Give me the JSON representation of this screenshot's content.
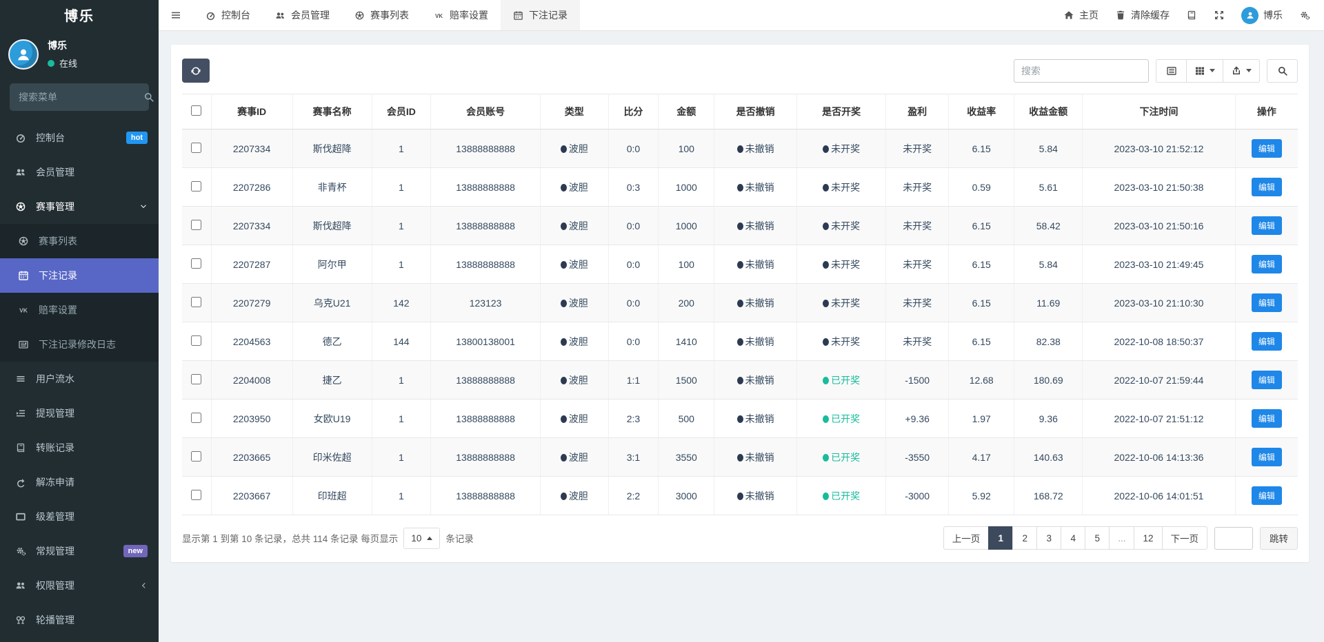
{
  "app": {
    "brand": "博乐"
  },
  "colors": {
    "sidebar_bg": "#222d32",
    "submenu_bg": "#1b252a",
    "active_menu": "#5867c6",
    "hot_badge": "#2196f3",
    "new_badge": "#7266ba",
    "online_dot": "#18bc9c",
    "primary_button": "#1e87e8",
    "pager_active": "#3d4a5d",
    "status_navy_dot": "#2c3a52",
    "drawn_green": "#18bc9c"
  },
  "sidebar": {
    "user": {
      "name": "博乐",
      "status": "在线"
    },
    "search_placeholder": "搜索菜单",
    "items": [
      {
        "id": "console",
        "label": "控制台",
        "icon": "gauge",
        "badge": "hot"
      },
      {
        "id": "member",
        "label": "会员管理",
        "icon": "users"
      },
      {
        "id": "match",
        "label": "赛事管理",
        "icon": "futbol",
        "open": true,
        "chevron": "down"
      },
      {
        "id": "match-list",
        "label": "赛事列表",
        "icon": "futbol",
        "sub": true
      },
      {
        "id": "bet-record",
        "label": "下注记录",
        "icon": "calendar",
        "sub": true,
        "active": true
      },
      {
        "id": "odds",
        "label": "赔率设置",
        "icon": "vk",
        "sub": true
      },
      {
        "id": "bet-log",
        "label": "下注记录修改日志",
        "icon": "log",
        "sub": true
      },
      {
        "id": "user-flow",
        "label": "用户流水",
        "icon": "flow"
      },
      {
        "id": "withdraw",
        "label": "提现管理",
        "icon": "withdraw"
      },
      {
        "id": "transfer",
        "label": "转账记录",
        "icon": "book"
      },
      {
        "id": "unfreeze",
        "label": "解冻申请",
        "icon": "redo"
      },
      {
        "id": "level",
        "label": "级差管理",
        "icon": "window"
      },
      {
        "id": "general",
        "label": "常规管理",
        "icon": "cogs",
        "badge": "new"
      },
      {
        "id": "permission",
        "label": "权限管理",
        "icon": "users",
        "chevron": "left"
      },
      {
        "id": "carousel",
        "label": "轮播管理",
        "icon": "rings"
      }
    ]
  },
  "topnav": {
    "tabs": [
      {
        "id": "console",
        "label": "控制台",
        "icon": "gauge"
      },
      {
        "id": "member",
        "label": "会员管理",
        "icon": "users"
      },
      {
        "id": "match-list",
        "label": "赛事列表",
        "icon": "futbol"
      },
      {
        "id": "odds",
        "label": "赔率设置",
        "icon": "vk"
      },
      {
        "id": "bet-record",
        "label": "下注记录",
        "icon": "calendar",
        "active": true
      }
    ],
    "home_label": "主页",
    "clear_cache_label": "清除缓存",
    "user_label": "博乐"
  },
  "toolbar": {
    "search_placeholder": "搜索"
  },
  "table": {
    "columns": [
      {
        "key": "check",
        "label": ""
      },
      {
        "key": "id",
        "label": "赛事ID"
      },
      {
        "key": "name",
        "label": "赛事名称"
      },
      {
        "key": "member_id",
        "label": "会员ID"
      },
      {
        "key": "account",
        "label": "会员账号"
      },
      {
        "key": "type",
        "label": "类型"
      },
      {
        "key": "score",
        "label": "比分"
      },
      {
        "key": "amount",
        "label": "金额"
      },
      {
        "key": "revoke",
        "label": "是否撤销"
      },
      {
        "key": "draw",
        "label": "是否开奖"
      },
      {
        "key": "profit",
        "label": "盈利"
      },
      {
        "key": "rate",
        "label": "收益率"
      },
      {
        "key": "earn",
        "label": "收益金额"
      },
      {
        "key": "time",
        "label": "下注时间"
      },
      {
        "key": "action",
        "label": "操作"
      }
    ],
    "rows": [
      {
        "id": "2207334",
        "name": "斯伐超降",
        "member_id": "1",
        "account": "13888888888",
        "type": "波胆",
        "score": "0:0",
        "amount": "100",
        "revoke": "未撤销",
        "draw": {
          "label": "未开奖",
          "status": "pending"
        },
        "profit": "未开奖",
        "rate": "6.15",
        "earn": "5.84",
        "time": "2023-03-10 21:52:12",
        "action": "编辑"
      },
      {
        "id": "2207286",
        "name": "非青杯",
        "member_id": "1",
        "account": "13888888888",
        "type": "波胆",
        "score": "0:3",
        "amount": "1000",
        "revoke": "未撤销",
        "draw": {
          "label": "未开奖",
          "status": "pending"
        },
        "profit": "未开奖",
        "rate": "0.59",
        "earn": "5.61",
        "time": "2023-03-10 21:50:38",
        "action": "编辑"
      },
      {
        "id": "2207334",
        "name": "斯伐超降",
        "member_id": "1",
        "account": "13888888888",
        "type": "波胆",
        "score": "0:0",
        "amount": "1000",
        "revoke": "未撤销",
        "draw": {
          "label": "未开奖",
          "status": "pending"
        },
        "profit": "未开奖",
        "rate": "6.15",
        "earn": "58.42",
        "time": "2023-03-10 21:50:16",
        "action": "编辑"
      },
      {
        "id": "2207287",
        "name": "阿尔甲",
        "member_id": "1",
        "account": "13888888888",
        "type": "波胆",
        "score": "0:0",
        "amount": "100",
        "revoke": "未撤销",
        "draw": {
          "label": "未开奖",
          "status": "pending"
        },
        "profit": "未开奖",
        "rate": "6.15",
        "earn": "5.84",
        "time": "2023-03-10 21:49:45",
        "action": "编辑"
      },
      {
        "id": "2207279",
        "name": "乌克U21",
        "member_id": "142",
        "account": "123123",
        "type": "波胆",
        "score": "0:0",
        "amount": "200",
        "revoke": "未撤销",
        "draw": {
          "label": "未开奖",
          "status": "pending"
        },
        "profit": "未开奖",
        "rate": "6.15",
        "earn": "11.69",
        "time": "2023-03-10 21:10:30",
        "action": "编辑"
      },
      {
        "id": "2204563",
        "name": "德乙",
        "member_id": "144",
        "account": "13800138001",
        "type": "波胆",
        "score": "0:0",
        "amount": "1410",
        "revoke": "未撤销",
        "draw": {
          "label": "未开奖",
          "status": "pending"
        },
        "profit": "未开奖",
        "rate": "6.15",
        "earn": "82.38",
        "time": "2022-10-08 18:50:37",
        "action": "编辑"
      },
      {
        "id": "2204008",
        "name": "捷乙",
        "member_id": "1",
        "account": "13888888888",
        "type": "波胆",
        "score": "1:1",
        "amount": "1500",
        "revoke": "未撤销",
        "draw": {
          "label": "已开奖",
          "status": "done"
        },
        "profit": "-1500",
        "rate": "12.68",
        "earn": "180.69",
        "time": "2022-10-07 21:59:44",
        "action": "编辑"
      },
      {
        "id": "2203950",
        "name": "女欧U19",
        "member_id": "1",
        "account": "13888888888",
        "type": "波胆",
        "score": "2:3",
        "amount": "500",
        "revoke": "未撤销",
        "draw": {
          "label": "已开奖",
          "status": "done"
        },
        "profit": "+9.36",
        "rate": "1.97",
        "earn": "9.36",
        "time": "2022-10-07 21:51:12",
        "action": "编辑"
      },
      {
        "id": "2203665",
        "name": "印米佐超",
        "member_id": "1",
        "account": "13888888888",
        "type": "波胆",
        "score": "3:1",
        "amount": "3550",
        "revoke": "未撤销",
        "draw": {
          "label": "已开奖",
          "status": "done"
        },
        "profit": "-3550",
        "rate": "4.17",
        "earn": "140.63",
        "time": "2022-10-06 14:13:36",
        "action": "编辑"
      },
      {
        "id": "2203667",
        "name": "印班超",
        "member_id": "1",
        "account": "13888888888",
        "type": "波胆",
        "score": "2:2",
        "amount": "3000",
        "revoke": "未撤销",
        "draw": {
          "label": "已开奖",
          "status": "done"
        },
        "profit": "-3000",
        "rate": "5.92",
        "earn": "168.72",
        "time": "2022-10-06 14:01:51",
        "action": "编辑"
      }
    ]
  },
  "pagination": {
    "summary_prefix": "显示第 1 到第 10 条记录，总共 114 条记录 每页显示",
    "page_size": "10",
    "summary_suffix": "条记录",
    "prev": "上一页",
    "next": "下一页",
    "pages": [
      "1",
      "2",
      "3",
      "4",
      "5",
      "...",
      "12"
    ],
    "active_page": "1",
    "jump_label": "跳转"
  }
}
